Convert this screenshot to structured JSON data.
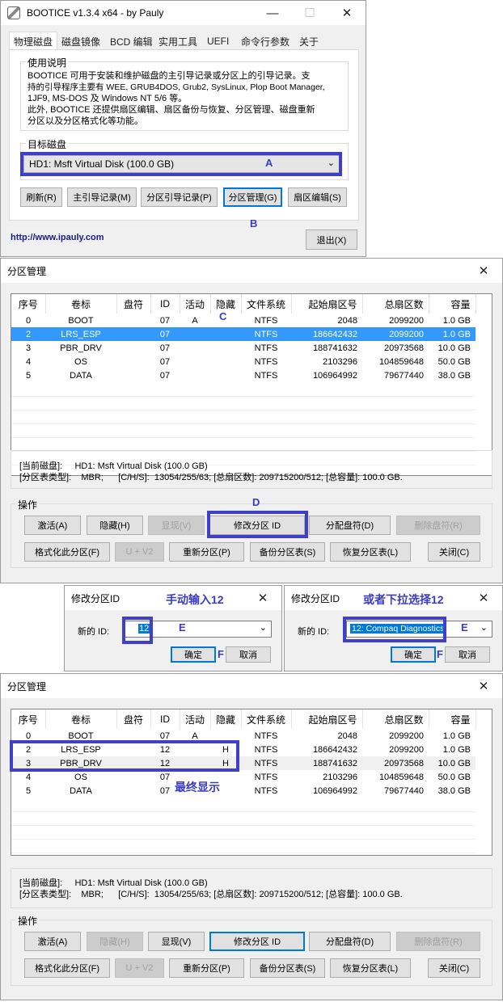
{
  "bootice": {
    "title": "BOOTICE v1.3.4 x64 - by Pauly",
    "tabs": [
      "物理磁盘",
      "磁盘镜像",
      "BCD 编辑",
      "实用工具",
      "UEFI",
      "命令行参数",
      "关于"
    ],
    "usage_legend": "使用说明",
    "usage_lines": [
      "BOOTICE 可用于安装和维护磁盘的主引导记录或分区上的引导记录。支",
      "持的引导程序主要有 WEE, GRUB4DOS, Grub2, SysLinux, Plop Boot Manager,",
      "1JF9, MS-DOS 及 Windows NT 5/6 等。",
      "此外, BOOTICE 还提供扇区编辑、扇区备份与恢复、分区管理、磁盘重新",
      "分区以及分区格式化等功能。"
    ],
    "target_legend": "目标磁盘",
    "disk_value": "HD1: Msft Virtual Disk (100.0 GB)",
    "buttons": [
      "刷新(R)",
      "主引导记录(M)",
      "分区引导记录(P)",
      "分区管理(G)",
      "扇区编辑(S)"
    ],
    "link": "http://www.ipauly.com",
    "exit": "退出(X)"
  },
  "annotations": {
    "A": "A",
    "B": "B",
    "C": "C",
    "D": "D",
    "E1": "E",
    "E2": "E",
    "F1": "F",
    "F2": "F",
    "manual": "手动输入12",
    "dropdown": "或者下拉选择12",
    "final": "最终显示"
  },
  "pm": {
    "title": "分区管理",
    "columns": [
      "序号",
      "卷标",
      "盘符",
      "ID",
      "活动",
      "隐藏",
      "文件系统",
      "起始扇区号",
      "总扇区数",
      "容量"
    ],
    "rows_before": [
      [
        "0",
        "BOOT",
        "",
        "07",
        "A",
        "",
        "NTFS",
        "2048",
        "2099200",
        "1.0 GB"
      ],
      [
        "2",
        "LRS_ESP",
        "",
        "07",
        "",
        "",
        "NTFS",
        "186642432",
        "2099200",
        "1.0 GB"
      ],
      [
        "3",
        "PBR_DRV",
        "",
        "07",
        "",
        "",
        "NTFS",
        "188741632",
        "20973568",
        "10.0 GB"
      ],
      [
        "4",
        "OS",
        "",
        "07",
        "",
        "",
        "NTFS",
        "2103296",
        "104859648",
        "50.0 GB"
      ],
      [
        "5",
        "DATA",
        "",
        "07",
        "",
        "",
        "NTFS",
        "106964992",
        "79677440",
        "38.0 GB"
      ]
    ],
    "rows_after": [
      [
        "0",
        "BOOT",
        "",
        "07",
        "A",
        "",
        "NTFS",
        "2048",
        "2099200",
        "1.0 GB"
      ],
      [
        "2",
        "LRS_ESP",
        "",
        "12",
        "",
        "H",
        "NTFS",
        "186642432",
        "2099200",
        "1.0 GB"
      ],
      [
        "3",
        "PBR_DRV",
        "",
        "12",
        "",
        "H",
        "NTFS",
        "188741632",
        "20973568",
        "10.0 GB"
      ],
      [
        "4",
        "OS",
        "",
        "07",
        "",
        "",
        "NTFS",
        "2103296",
        "104859648",
        "50.0 GB"
      ],
      [
        "5",
        "DATA",
        "",
        "07",
        "",
        "",
        "NTFS",
        "106964992",
        "79677440",
        "38.0 GB"
      ]
    ],
    "info_line1_label": "[当前磁盘]:",
    "info_line1_value": "HD1: Msft Virtual Disk (100.0 GB)",
    "info_line2": "[分区表类型]:    MBR;      [C/H/S]:  13054/255/63; [总扇区数]: 209715200/512; [总容量]: 100.0 GB.",
    "ops_legend": "操作",
    "btns_row1": [
      "激活(A)",
      "隐藏(H)",
      "显现(V)",
      "修改分区 ID",
      "分配盘符(D)",
      "删除盘符(R)"
    ],
    "btns_row2": [
      "格式化此分区(F)",
      "U + V2",
      "重新分区(P)",
      "备份分区表(S)",
      "恢复分区表(L)",
      "关闭(C)"
    ]
  },
  "dlg": {
    "title": "修改分区ID",
    "label": "新的 ID:",
    "value_manual": "12",
    "value_dropdown": "12: Compaq Diagnostics",
    "ok": "确定",
    "cancel": "取消"
  }
}
